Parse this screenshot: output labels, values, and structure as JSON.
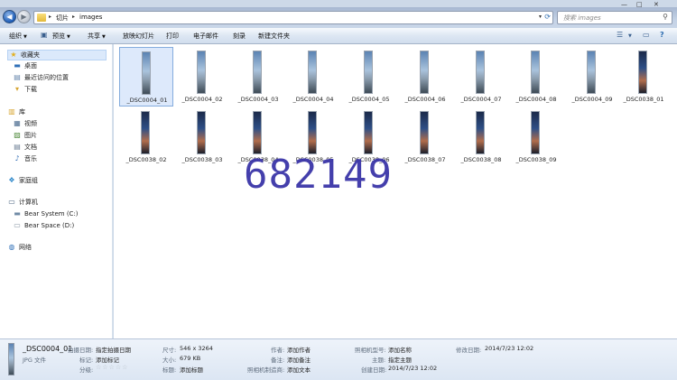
{
  "address": {
    "crumbs": [
      "切片",
      "images"
    ],
    "search_placeholder": "搜索 images"
  },
  "toolbar": {
    "items": [
      "组织",
      "预览",
      "共享",
      "放映幻灯片",
      "打印",
      "电子邮件",
      "刻录",
      "新建文件夹"
    ]
  },
  "sidebar": {
    "favorites": "收藏夹",
    "desktop": "桌面",
    "recent": "最近访问的位置",
    "downloads": "下载",
    "library": "库",
    "videos": "视频",
    "pictures": "图片",
    "documents": "文档",
    "music": "音乐",
    "homegroup": "家庭组",
    "computer": "计算机",
    "drive_c": "Bear System (C:)",
    "drive_d": "Bear Space (D:)",
    "network": "网络"
  },
  "files": {
    "row1": [
      "_DSC0004_01",
      "_DSC0004_02",
      "_DSC0004_03",
      "_DSC0004_04",
      "_DSC0004_05",
      "_DSC0004_06",
      "_DSC0004_07",
      "_DSC0004_08",
      "_DSC0004_09",
      "_DSC0038_01"
    ],
    "row2": [
      "_DSC0038_02",
      "_DSC0038_03",
      "_DSC0038_04",
      "_DSC0038_05",
      "_DSC0038_06",
      "_DSC0038_07",
      "_DSC0038_08",
      "_DSC0038_09"
    ]
  },
  "watermark": "682149",
  "details": {
    "name": "_DSC0004_01",
    "type": "JPG 文件",
    "shot_date_label": "拍摄日期:",
    "shot_date": "指定拍摄日期",
    "tags_label": "标记:",
    "tags": "添加标记",
    "rating_label": "分级:",
    "dims_label": "尺寸:",
    "dims": "546 x 3264",
    "size_label": "大小:",
    "size": "679 KB",
    "title_label": "标题:",
    "title": "添加标题",
    "author_label": "作者:",
    "author": "添加作者",
    "comment_label": "备注:",
    "comment": "添加备注",
    "maker_label": "照相机制造商:",
    "maker": "添加文本",
    "model_label": "照相机型号:",
    "model": "添加名称",
    "subject_label": "主题:",
    "subject": "指定主题",
    "created_label": "创建日期:",
    "created": "2014/7/23 12:02",
    "modified_label": "修改日期:",
    "modified": "2014/7/23 12:02"
  }
}
